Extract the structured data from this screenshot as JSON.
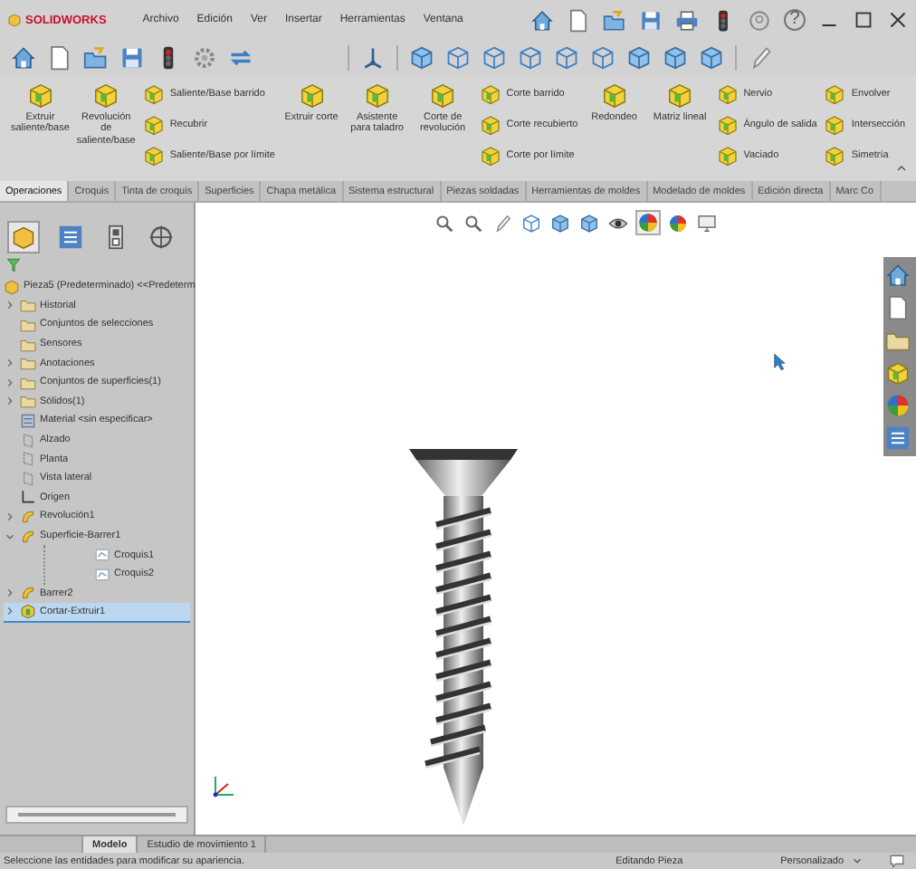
{
  "title_bar": {
    "logo": "SOLIDWORKS",
    "menus": [
      "Archivo",
      "Edición",
      "Ver",
      "Insertar",
      "Herramientas",
      "Ventana"
    ],
    "help": "?"
  },
  "ribbon": [
    {
      "kind": "large",
      "label": "Extruir saliente/base"
    },
    {
      "kind": "large",
      "label": "Revolución de saliente/base"
    },
    {
      "kind": "stack",
      "items": [
        "Saliente/Base barrido",
        "Recubrir",
        "Saliente/Base por límite"
      ]
    },
    {
      "kind": "large",
      "label": "Extruir corte"
    },
    {
      "kind": "large",
      "label": "Asistente para taladro"
    },
    {
      "kind": "large",
      "label": "Corte de revolución"
    },
    {
      "kind": "stack",
      "items": [
        "Corte barrido",
        "Corte recubierto",
        "Corte por límite"
      ]
    },
    {
      "kind": "large",
      "label": "Redondeo"
    },
    {
      "kind": "large",
      "label": "Matriz lineal"
    },
    {
      "kind": "stack",
      "items": [
        "Nervio",
        "Ángulo de salida",
        "Vaciado"
      ]
    },
    {
      "kind": "stack",
      "items": [
        "Envolver",
        "Intersección",
        "Simetría"
      ]
    }
  ],
  "command_tabs": [
    {
      "label": "Operaciones",
      "selected": true
    },
    {
      "label": "Croquis",
      "selected": false
    },
    {
      "label": "Tinta de croquis",
      "selected": false
    },
    {
      "label": "Superficies",
      "selected": false
    },
    {
      "label": "Chapa metálica",
      "selected": false
    },
    {
      "label": "Sistema estructural",
      "selected": false
    },
    {
      "label": "Piezas soldadas",
      "selected": false
    },
    {
      "label": "Herramientas de moldes",
      "selected": false
    },
    {
      "label": "Modelado de moldes",
      "selected": false
    },
    {
      "label": "Edición directa",
      "selected": false
    },
    {
      "label": "Marc Co",
      "selected": false
    }
  ],
  "feature_tree": {
    "root": "Pieza5 (Predeterminado) <<Predeterm",
    "items": [
      {
        "label": "Historial",
        "kind": "folder",
        "expanded": false,
        "selected": false
      },
      {
        "label": "Conjuntos de selecciones",
        "kind": "folder",
        "selected": false
      },
      {
        "label": "Sensores",
        "kind": "folder",
        "selected": false
      },
      {
        "label": "Anotaciones",
        "kind": "folder",
        "expanded": false,
        "selected": false
      },
      {
        "label": "Conjuntos de superficies(1)",
        "kind": "folder",
        "expanded": false,
        "selected": false
      },
      {
        "label": "Sólidos(1)",
        "kind": "folder",
        "expanded": false,
        "selected": false
      },
      {
        "label": "Material <sin especificar>",
        "kind": "material",
        "selected": false
      },
      {
        "label": "Alzado",
        "kind": "plane",
        "selected": false
      },
      {
        "label": "Planta",
        "kind": "plane",
        "selected": false
      },
      {
        "label": "Vista lateral",
        "kind": "plane",
        "selected": false
      },
      {
        "label": "Origen",
        "kind": "origin",
        "selected": false
      },
      {
        "label": "Revolución1",
        "kind": "feature",
        "expanded": false,
        "selected": false
      },
      {
        "label": "Superficie-Barrer1",
        "kind": "feature",
        "expanded": true,
        "selected": false,
        "children": [
          {
            "label": "Croquis1",
            "kind": "sketch",
            "selected": false
          },
          {
            "label": "Croquis2",
            "kind": "sketch",
            "selected": false
          }
        ]
      },
      {
        "label": "Barrer2",
        "kind": "feature",
        "expanded": false,
        "selected": false
      },
      {
        "label": "Cortar-Extruir1",
        "kind": "cut",
        "expanded": false,
        "selected": true
      }
    ]
  },
  "bottom_tabs": [
    {
      "label": "Modelo",
      "selected": true
    },
    {
      "label": "Estudio de movimiento 1",
      "selected": false
    }
  ],
  "status_bar": {
    "message": "Seleccione las entidades para modificar su apariencia.",
    "mode": "Editando Pieza",
    "units": "Personalizado"
  }
}
